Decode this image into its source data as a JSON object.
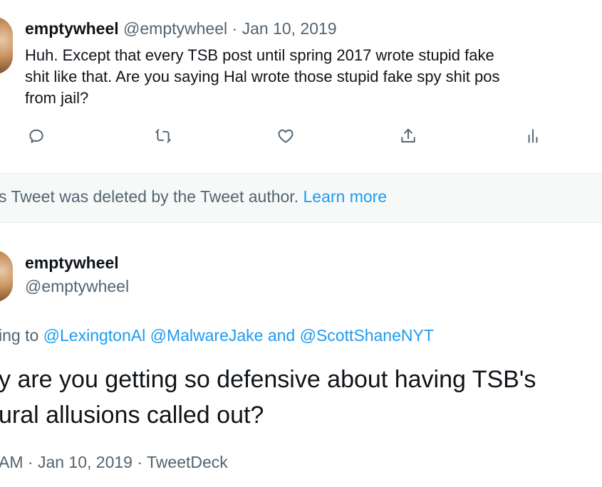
{
  "tweet1": {
    "display_name": "emptywheel",
    "handle": "@emptywheel",
    "separator": "·",
    "date": "Jan 10, 2019",
    "text_lines": [
      "Huh. Except that every TSB post until spring 2017 wrote stupid fake",
      "shit like that. Are you saying Hal wrote those stupid fake spy shit pos",
      "from jail?"
    ],
    "actions": [
      "reply-icon",
      "retweet-icon",
      "like-icon",
      "share-icon",
      "analytics-icon"
    ]
  },
  "deleted_notice": {
    "text": "s Tweet was deleted by the Tweet author.",
    "link": "Learn more"
  },
  "tweet2": {
    "display_name": "emptywheel",
    "handle": "@emptywheel",
    "replying_prefix": "ing to",
    "mentions": [
      "@LexingtonAl",
      "@MalwareJake"
    ],
    "mention_joiner": "and",
    "mention_last": "@ScottShaneNYT",
    "text_lines": [
      "y are you getting so defensive about having TSB's",
      "ural allusions called out?"
    ],
    "meta": {
      "time": "AM",
      "separator": "·",
      "date": "Jan 10, 2019",
      "source": "TweetDeck"
    }
  },
  "colors": {
    "link": "#1d9bf0",
    "muted": "#536471",
    "text": "#0f1419",
    "deleted_bg": "#f7f9f9"
  }
}
